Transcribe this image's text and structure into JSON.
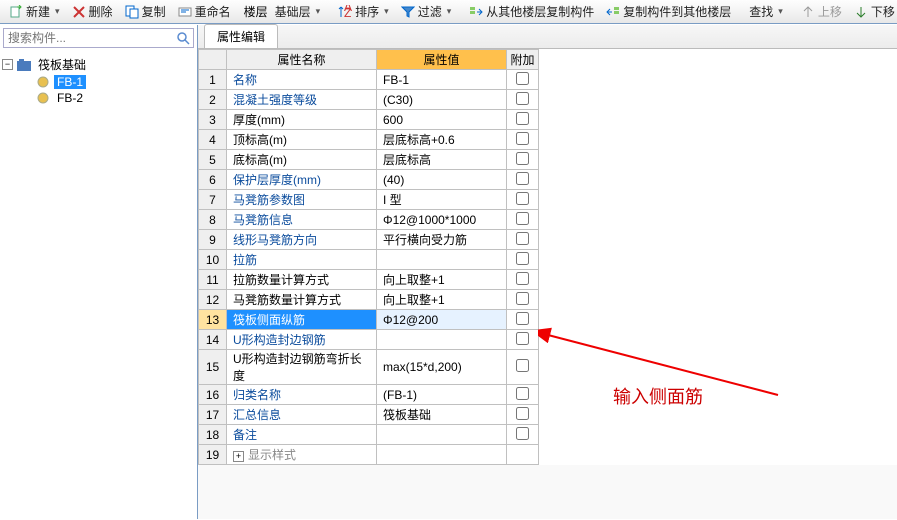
{
  "toolbar": {
    "new": "新建",
    "del": "删除",
    "copy": "复制",
    "rename": "重命名",
    "floor_lbl": "楼层",
    "floor_val": "基础层",
    "sort": "排序",
    "filter": "过滤",
    "copy_from": "从其他楼层复制构件",
    "copy_to": "复制构件到其他楼层",
    "find": "查找",
    "up": "上移",
    "down": "下移"
  },
  "search": {
    "placeholder": "搜索构件..."
  },
  "tree": {
    "root": "筏板基础",
    "items": [
      {
        "label": "FB-1"
      },
      {
        "label": "FB-2"
      }
    ],
    "selected": 0
  },
  "tab": "属性编辑",
  "headers": {
    "name": "属性名称",
    "value": "属性值",
    "extra": "附加"
  },
  "rows": [
    {
      "n": "1",
      "name": "名称",
      "v": "FB-1",
      "blk": false,
      "chk": true
    },
    {
      "n": "2",
      "name": "混凝土强度等级",
      "v": "(C30)",
      "blk": false,
      "chk": true
    },
    {
      "n": "3",
      "name": "厚度(mm)",
      "v": "600",
      "blk": true,
      "chk": true
    },
    {
      "n": "4",
      "name": "顶标高(m)",
      "v": "层底标高+0.6",
      "blk": true,
      "chk": true
    },
    {
      "n": "5",
      "name": "底标高(m)",
      "v": "层底标高",
      "blk": true,
      "chk": true
    },
    {
      "n": "6",
      "name": "保护层厚度(mm)",
      "v": "(40)",
      "blk": false,
      "chk": true
    },
    {
      "n": "7",
      "name": "马凳筋参数图",
      "v": "I 型",
      "blk": false,
      "chk": true
    },
    {
      "n": "8",
      "name": "马凳筋信息",
      "v": "Φ12@1000*1000",
      "blk": false,
      "chk": true
    },
    {
      "n": "9",
      "name": "线形马凳筋方向",
      "v": "平行横向受力筋",
      "blk": false,
      "chk": true
    },
    {
      "n": "10",
      "name": "拉筋",
      "v": "",
      "blk": false,
      "chk": true
    },
    {
      "n": "11",
      "name": "拉筋数量计算方式",
      "v": "向上取整+1",
      "blk": true,
      "chk": true
    },
    {
      "n": "12",
      "name": "马凳筋数量计算方式",
      "v": "向上取整+1",
      "blk": true,
      "chk": true
    },
    {
      "n": "13",
      "name": "筏板侧面纵筋",
      "v": "Φ12@200",
      "blk": false,
      "chk": true,
      "sel": true
    },
    {
      "n": "14",
      "name": "U形构造封边钢筋",
      "v": "",
      "blk": false,
      "chk": true
    },
    {
      "n": "15",
      "name": "U形构造封边钢筋弯折长度",
      "v": "max(15*d,200)",
      "blk": true,
      "chk": true
    },
    {
      "n": "16",
      "name": "归类名称",
      "v": "(FB-1)",
      "blk": false,
      "chk": true
    },
    {
      "n": "17",
      "name": "汇总信息",
      "v": "筏板基础",
      "blk": false,
      "chk": true
    },
    {
      "n": "18",
      "name": "备注",
      "v": "",
      "blk": false,
      "chk": true
    },
    {
      "n": "19",
      "name": "显示样式",
      "v": "",
      "blk": true,
      "chk": false,
      "exp": true
    }
  ],
  "annotation": "输入侧面筋"
}
